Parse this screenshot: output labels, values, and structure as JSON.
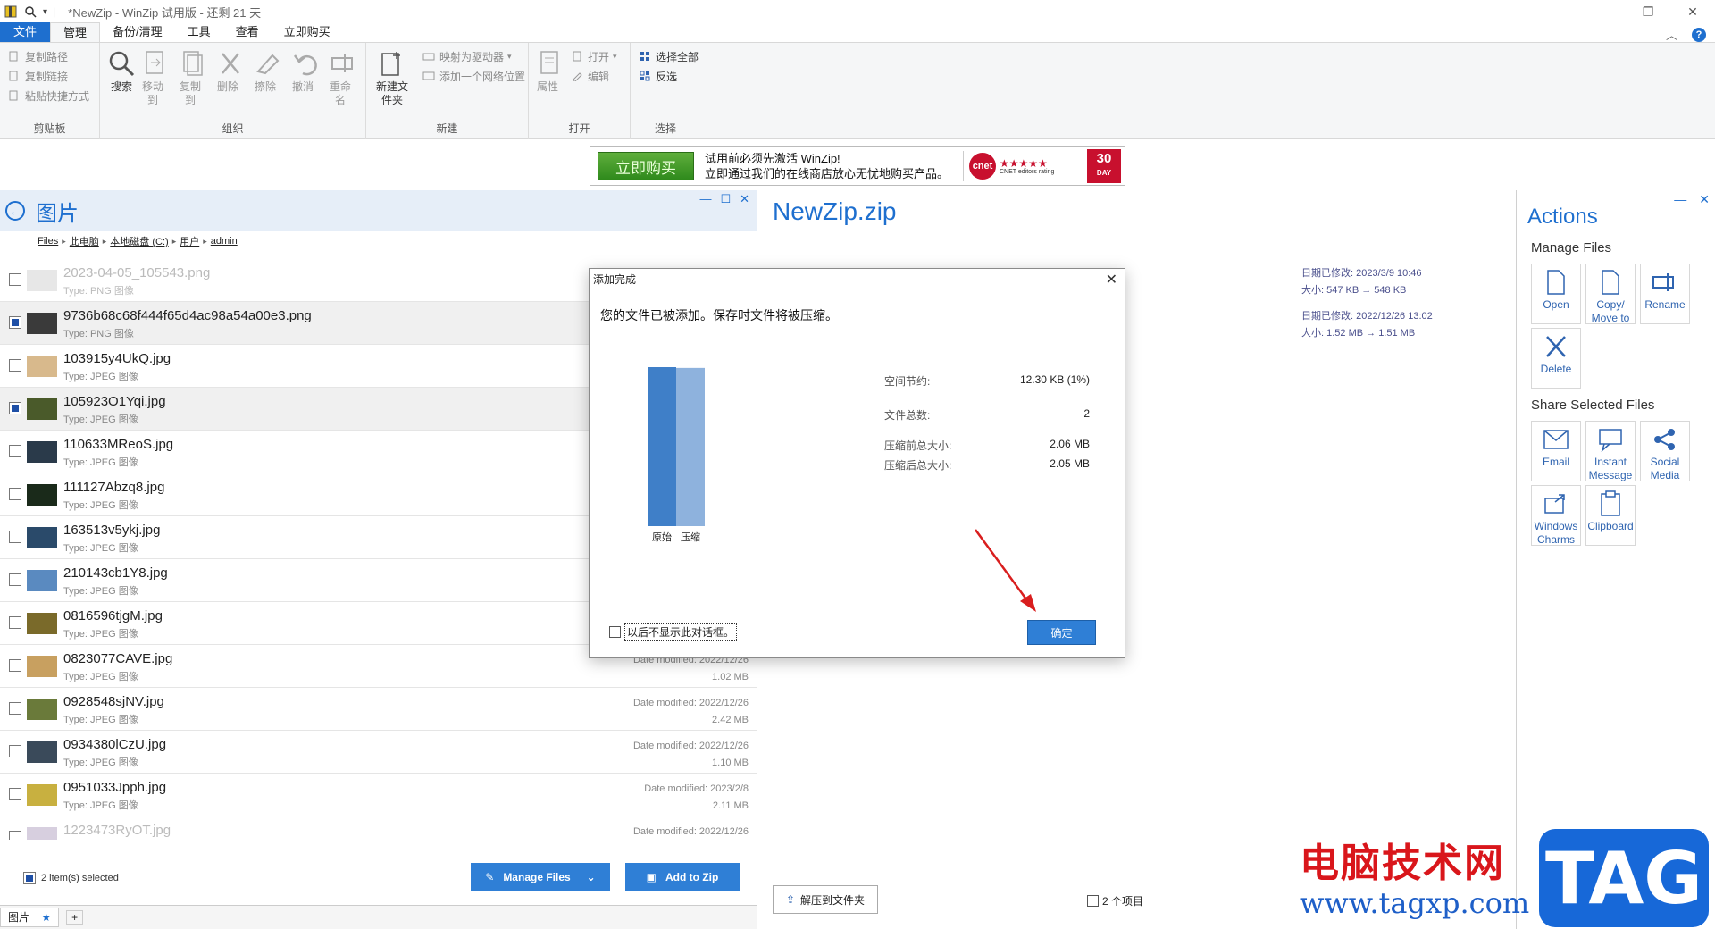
{
  "window": {
    "title": "*NewZip - WinZip 试用版 - 还剩 21 天"
  },
  "menu": {
    "tabs": [
      "文件",
      "管理",
      "备份/清理",
      "工具",
      "查看",
      "立即购买"
    ],
    "active": "管理"
  },
  "ribbon": {
    "clipboard": {
      "items": [
        "复制路径",
        "复制链接",
        "粘贴快捷方式"
      ],
      "label": "剪贴板"
    },
    "organize": {
      "buttons": [
        {
          "label": "搜索",
          "icon": "search-icon"
        },
        {
          "label": "移动到",
          "icon": "move-icon"
        },
        {
          "label": "复制到",
          "icon": "copy-icon"
        },
        {
          "label": "删除",
          "icon": "delete-icon"
        },
        {
          "label": "擦除",
          "icon": "wipe-icon"
        },
        {
          "label": "撤消",
          "icon": "undo-icon"
        },
        {
          "label": "重命名",
          "icon": "rename-icon"
        }
      ],
      "label": "组织"
    },
    "new": {
      "new_folder": "新建文件夹",
      "map_drive": "映射为驱动器",
      "add_network": "添加一个网络位置",
      "label": "新建"
    },
    "open": {
      "properties": "属性",
      "open": "打开",
      "edit": "编辑",
      "label": "打开"
    },
    "select": {
      "select_all": "选择全部",
      "invert": "反选",
      "label": "选择"
    }
  },
  "banner": {
    "buy_label": "立即购买",
    "line1": "试用前必须先激活 WinZip!",
    "line2": "立即通过我们的在线商店放心无忧地购买产品。",
    "cnet": "cnet",
    "stars": "★★★★★",
    "cnet_caption": "CNET editors rating",
    "days": "30",
    "day_word": "DAY"
  },
  "left_pane": {
    "title": "图片",
    "breadcrumb": [
      "Files",
      "此电脑",
      "本地磁盘 (C:)",
      "用户",
      "admin"
    ],
    "files": [
      {
        "name": "2023-04-05_105543.png",
        "type": "Type: PNG 图像",
        "checked": false,
        "selected": false,
        "faded": true,
        "modified": "",
        "size": "",
        "thumb": "#cfcfcf"
      },
      {
        "name": "9736b68c68f444f65d4ac98a54a00e3.png",
        "type": "Type: PNG 图像",
        "checked": true,
        "selected": true,
        "faded": false,
        "modified": "",
        "size": "",
        "thumb": "#3a3a3a"
      },
      {
        "name": "103915y4UkQ.jpg",
        "type": "Type: JPEG 图像",
        "checked": false,
        "selected": false,
        "faded": false,
        "modified": "",
        "size": "",
        "thumb": "#d8b98c"
      },
      {
        "name": "105923O1Yqi.jpg",
        "type": "Type: JPEG 图像",
        "checked": true,
        "selected": true,
        "faded": false,
        "modified": "",
        "size": "",
        "thumb": "#4a5a2a"
      },
      {
        "name": "110633MReoS.jpg",
        "type": "Type: JPEG 图像",
        "checked": false,
        "selected": false,
        "faded": false,
        "modified": "",
        "size": "",
        "thumb": "#2a3a4a"
      },
      {
        "name": "111127Abzq8.jpg",
        "type": "Type: JPEG 图像",
        "checked": false,
        "selected": false,
        "faded": false,
        "modified": "",
        "size": "",
        "thumb": "#1a2a1a"
      },
      {
        "name": "163513v5ykj.jpg",
        "type": "Type: JPEG 图像",
        "checked": false,
        "selected": false,
        "faded": false,
        "modified": "",
        "size": "",
        "thumb": "#2a4a6a"
      },
      {
        "name": "210143cb1Y8.jpg",
        "type": "Type: JPEG 图像",
        "checked": false,
        "selected": false,
        "faded": false,
        "modified": "",
        "size": "",
        "thumb": "#5a8ac0"
      },
      {
        "name": "0816596tjgM.jpg",
        "type": "Type: JPEG 图像",
        "checked": false,
        "selected": false,
        "faded": false,
        "modified": "",
        "size": "",
        "thumb": "#7a6a2a"
      },
      {
        "name": "0823077CAVE.jpg",
        "type": "Type: JPEG 图像",
        "checked": false,
        "selected": false,
        "faded": false,
        "modified": "Date modified: 2022/12/26",
        "size": "1.02 MB",
        "thumb": "#c8a060"
      },
      {
        "name": "0928548sjNV.jpg",
        "type": "Type: JPEG 图像",
        "checked": false,
        "selected": false,
        "faded": false,
        "modified": "Date modified: 2022/12/26",
        "size": "2.42 MB",
        "thumb": "#6a7a3a"
      },
      {
        "name": "0934380lCzU.jpg",
        "type": "Type: JPEG 图像",
        "checked": false,
        "selected": false,
        "faded": false,
        "modified": "Date modified: 2022/12/26",
        "size": "1.10 MB",
        "thumb": "#3a4a5a"
      },
      {
        "name": "0951033Jpph.jpg",
        "type": "Type: JPEG 图像",
        "checked": false,
        "selected": false,
        "faded": false,
        "modified": "Date modified: 2023/2/8",
        "size": "2.11 MB",
        "thumb": "#c8b040"
      },
      {
        "name": "1223473RyOT.jpg",
        "type": "Type: JPEG 图像",
        "checked": false,
        "selected": false,
        "faded": true,
        "modified": "Date modified: 2022/12/26",
        "size": "",
        "thumb": "#b0a0c0"
      }
    ],
    "selected_count": "2 item(s) selected",
    "manage_files": "Manage Files",
    "add_to_zip": "Add to Zip",
    "tab_label": "图片",
    "tab_pin": "★",
    "tab_add": "+"
  },
  "zip_pane": {
    "title": "NewZip.zip",
    "entries": [
      {
        "modified": "日期已修改: 2023/3/9 10:46",
        "size": "大小: 547 KB → 548 KB"
      },
      {
        "modified": "日期已修改: 2022/12/26 13:02",
        "size": "大小: 1.52 MB → 1.51 MB"
      }
    ],
    "extract_label": "解压到文件夹",
    "item_count": "2 个项目"
  },
  "actions": {
    "title": "Actions",
    "manage_title": "Manage Files",
    "manage": [
      {
        "label": "Open",
        "icon": "open-file-icon"
      },
      {
        "label": "Copy/ Move to",
        "icon": "copy-move-icon"
      },
      {
        "label": "Rename",
        "icon": "rename-icon"
      },
      {
        "label": "Delete",
        "icon": "delete-icon"
      }
    ],
    "share_title": "Share Selected Files",
    "share": [
      {
        "label": "Email",
        "icon": "email-icon"
      },
      {
        "label": "Instant Message",
        "icon": "instant-message-icon"
      },
      {
        "label": "Social Media",
        "icon": "social-media-icon"
      },
      {
        "label": "Windows Charms",
        "icon": "windows-charms-icon"
      },
      {
        "label": "Clipboard",
        "icon": "clipboard-icon"
      }
    ]
  },
  "dialog": {
    "title": "添加完成",
    "message": "您的文件已被添加。保存时文件将被压缩。",
    "chart_data": {
      "type": "bar",
      "categories": [
        "原始",
        "压缩"
      ],
      "values": [
        2.06,
        2.05
      ],
      "colors": [
        "#3f7fc8",
        "#8eb2dd"
      ]
    },
    "stats": [
      {
        "label": "空间节约:",
        "value": "12.30 KB (1%)"
      },
      {
        "label": "文件总数:",
        "value": "2"
      },
      {
        "label": "压缩前总大小:",
        "value": "2.06 MB"
      },
      {
        "label": "压缩后总大小:",
        "value": "2.05 MB"
      }
    ],
    "dont_show": "以后不显示此对话框。",
    "ok_label": "确定"
  },
  "watermark": {
    "cn": "电脑技术网",
    "url": "www.tagxp.com",
    "tag": "TAG"
  }
}
